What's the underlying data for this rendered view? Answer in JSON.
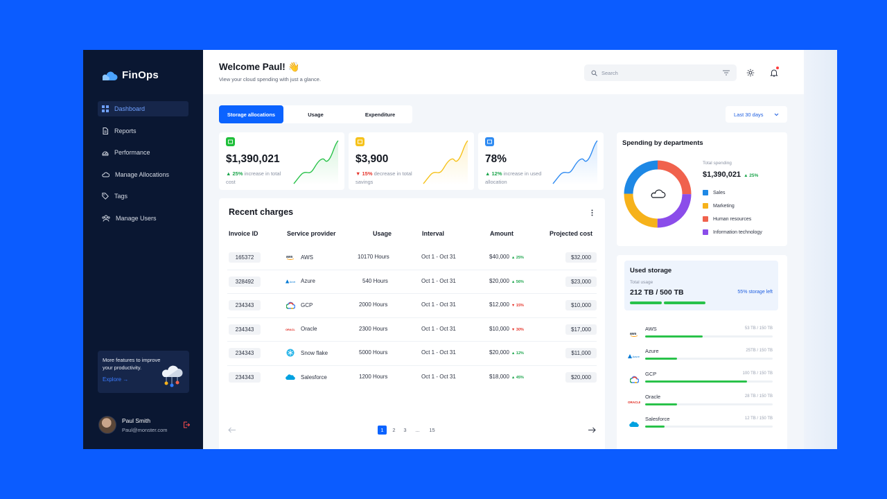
{
  "app": {
    "name": "FinOps"
  },
  "sidebar": {
    "items": [
      {
        "label": "Dashboard",
        "icon": "grid-icon",
        "active": true
      },
      {
        "label": "Reports",
        "icon": "document-icon"
      },
      {
        "label": "Performance",
        "icon": "gauge-icon"
      },
      {
        "label": "Manage Allocations",
        "icon": "cloud-icon"
      },
      {
        "label": "Tags",
        "icon": "tag-icon"
      },
      {
        "label": "Manage Users",
        "icon": "users-icon"
      }
    ],
    "promo": {
      "text": "More features to improve your productivity.",
      "link": "Explore →"
    },
    "user": {
      "name": "Paul Smith",
      "email": "Paul@monster.com"
    }
  },
  "header": {
    "welcome": "Welcome Paul! 👋",
    "subtitle": "View your cloud spending with just a glance.",
    "search_placeholder": "Search"
  },
  "tabs": [
    "Storage allocations",
    "Usage",
    "Expenditure"
  ],
  "date_range": "Last 30 days",
  "kpis": [
    {
      "value": "$1,390,021",
      "pct": "25%",
      "text": "increase in total cost",
      "direction": "up",
      "color": "#1ba54b"
    },
    {
      "value": "$3,900",
      "pct": "15%",
      "text": "decrease in total savings",
      "direction": "down",
      "color": "#e5342a"
    },
    {
      "value": "78%",
      "pct": "12%",
      "text": "increase in used allocation",
      "direction": "up",
      "color": "#1ba54b"
    }
  ],
  "charges": {
    "title": "Recent charges",
    "columns": [
      "Invoice ID",
      "Service provider",
      "Usage",
      "Interval",
      "Amount",
      "Projected cost"
    ],
    "rows": [
      {
        "id": "165372",
        "provider": "AWS",
        "usage": "10170 Hours",
        "interval": "Oct 1 - Oct 31",
        "amount": "$40,000",
        "tag": "▲ 25%",
        "dir": "up",
        "projected": "$32,000"
      },
      {
        "id": "328492",
        "provider": "Azure",
        "usage": "540 Hours",
        "interval": "Oct 1 - Oct 31",
        "amount": "$20,000",
        "tag": "▲ 56%",
        "dir": "up",
        "projected": "$23,000"
      },
      {
        "id": "234343",
        "provider": "GCP",
        "usage": "2000 Hours",
        "interval": "Oct 1 - Oct 31",
        "amount": "$12,000",
        "tag": "▼ 15%",
        "dir": "down",
        "projected": "$10,000"
      },
      {
        "id": "234343",
        "provider": "Oracle",
        "usage": "2300 Hours",
        "interval": "Oct 1 - Oct 31",
        "amount": "$10,000",
        "tag": "▼ 30%",
        "dir": "down",
        "projected": "$17,000"
      },
      {
        "id": "234343",
        "provider": "Snow flake",
        "usage": "5000 Hours",
        "interval": "Oct 1 - Oct 31",
        "amount": "$20,000",
        "tag": "▲ 12%",
        "dir": "up",
        "projected": "$11,000"
      },
      {
        "id": "234343",
        "provider": "Salesforce",
        "usage": "1200 Hours",
        "interval": "Oct 1 - Oct 31",
        "amount": "$18,000",
        "tag": "▲ 45%",
        "dir": "up",
        "projected": "$20,000"
      }
    ],
    "pages": [
      "1",
      "2",
      "3",
      "...",
      "15"
    ]
  },
  "departments": {
    "title": "Spending by departments",
    "total_label": "Total spending",
    "total": "$1,390,021",
    "total_pct": "▲ 25%",
    "legend": [
      {
        "label": "Sales",
        "color": "#1e88e5"
      },
      {
        "label": "Marketing",
        "color": "#f6b21b"
      },
      {
        "label": "Human resources",
        "color": "#f0624d"
      },
      {
        "label": "Information technology",
        "color": "#8b4dea"
      }
    ]
  },
  "storage": {
    "title": "Used storage",
    "total_label": "Total usage",
    "total": "212 TB / 500 TB",
    "left": "55% storage left",
    "providers": [
      {
        "name": "AWS",
        "cap": "53 TB / 150 TB",
        "fill": 0.45
      },
      {
        "name": "Azure",
        "cap": "25TB / 150 TB",
        "fill": 0.25
      },
      {
        "name": "GCP",
        "cap": "100 TB / 150 TB",
        "fill": 0.8
      },
      {
        "name": "Oracle",
        "cap": "28 TB / 150 TB",
        "fill": 0.25
      },
      {
        "name": "Salesforce",
        "cap": "12 TB / 150 TB",
        "fill": 0.15
      }
    ]
  }
}
